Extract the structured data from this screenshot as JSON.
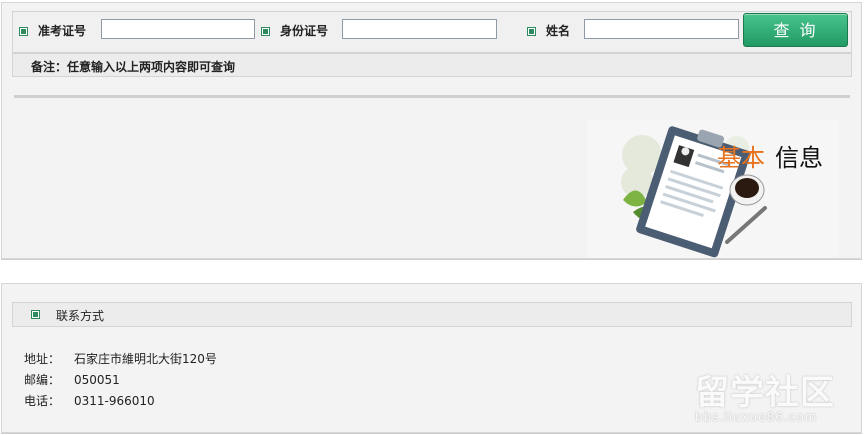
{
  "search": {
    "exam_label": "准考证号",
    "id_label": "身份证号",
    "name_label": "姓名",
    "exam_value": "",
    "id_value": "",
    "name_value": "",
    "button_label": "查询",
    "note": "备注：任意输入以上两项内容即可查询"
  },
  "info_image": {
    "text_part1": "基本",
    "text_part2": "信息"
  },
  "contact": {
    "title": "联系方式",
    "address_label": "地址：",
    "address_value": "石家庄市維明北大街120号",
    "postcode_label": "邮编：",
    "postcode_value": "050051",
    "phone_label": "电话：",
    "phone_value": "0311-966010"
  },
  "watermark": {
    "title": "留学社区",
    "url": "bbs.liuxue86.com"
  },
  "colors": {
    "accent": "#2f8a5f",
    "button": "#219a63",
    "orange": "#e8731c"
  }
}
